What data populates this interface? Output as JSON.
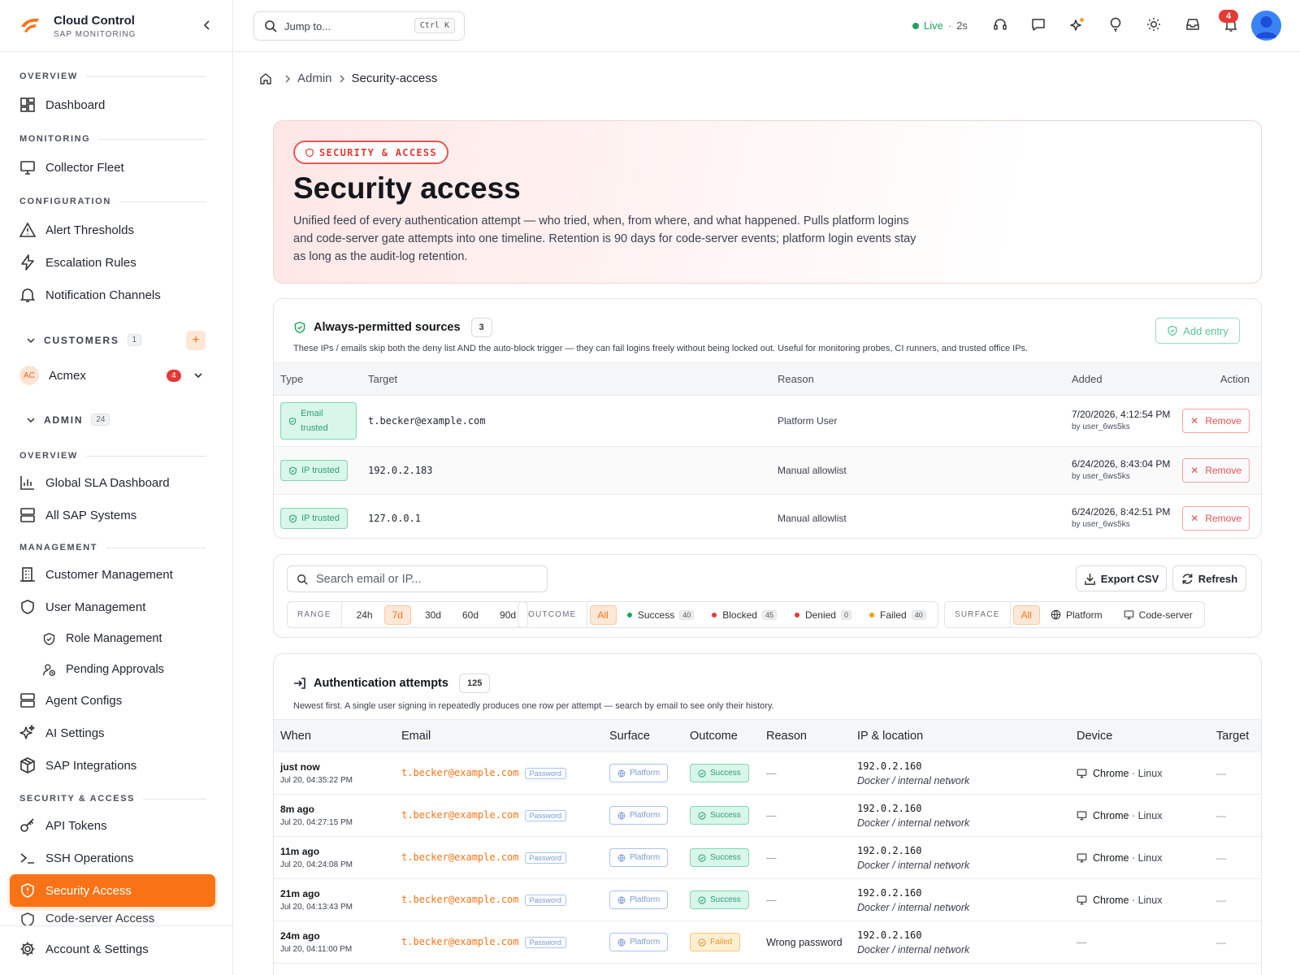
{
  "app": {
    "title": "Cloud Control",
    "subtitle": "SAP MONITORING"
  },
  "sidebar": {
    "sections": {
      "overview": "OVERVIEW",
      "monitoring": "MONITORING",
      "configuration": "CONFIGURATION",
      "admin_overview": "OVERVIEW",
      "management": "MANAGEMENT",
      "security": "SECURITY & ACCESS"
    },
    "items": {
      "dashboard": "Dashboard",
      "collector_fleet": "Collector Fleet",
      "alert_thresholds": "Alert Thresholds",
      "escalation_rules": "Escalation Rules",
      "notification_channels": "Notification Channels",
      "global_sla": "Global SLA Dashboard",
      "all_sap": "All SAP Systems",
      "customer_mgmt": "Customer Management",
      "user_mgmt": "User Management",
      "role_mgmt": "Role Management",
      "pending_approvals": "Pending Approvals",
      "agent_configs": "Agent Configs",
      "ai_settings": "AI Settings",
      "sap_integrations": "SAP Integrations",
      "api_tokens": "API Tokens",
      "ssh_operations": "SSH Operations",
      "security_access": "Security Access",
      "code_server_access": "Code-server Access",
      "account_settings": "Account & Settings"
    },
    "customers": {
      "label": "CUSTOMERS",
      "count": "1",
      "add": "+"
    },
    "customer": {
      "initials": "AC",
      "name": "Acmex",
      "badge": "4"
    },
    "admin": {
      "label": "ADMIN",
      "count": "24"
    }
  },
  "topbar": {
    "search_placeholder": "Jump to...",
    "shortcut": "Ctrl K",
    "live_label": "Live",
    "live_age": "2s",
    "notification_count": "4"
  },
  "breadcrumb": {
    "admin": "Admin",
    "current": "Security-access"
  },
  "hero": {
    "pill": "SECURITY & ACCESS",
    "title": "Security access",
    "description": "Unified feed of every authentication attempt — who tried, when, from where, and what happened. Pulls platform logins and code-server gate attempts into one timeline. Retention is 90 days for code-server events; platform login events stay as long as the audit-log retention."
  },
  "permitted": {
    "title": "Always-permitted sources",
    "count": "3",
    "description": "These IPs / emails skip both the deny list AND the auto-block trigger — they can fail logins freely without being locked out. Useful for monitoring probes, CI runners, and trusted office IPs.",
    "add_label": "Add entry",
    "columns": [
      "Type",
      "Target",
      "Reason",
      "Added",
      "Action"
    ],
    "remove_label": "Remove",
    "rows": [
      {
        "type": "Email trusted",
        "target": "t.becker@example.com",
        "reason": "Platform User",
        "added": "7/20/2026, 4:12:54 PM",
        "by": "by user_6ws5ks"
      },
      {
        "type": "IP trusted",
        "target": "192.0.2.183",
        "reason": "Manual allowlist",
        "added": "6/24/2026, 8:43:04 PM",
        "by": "by user_6ws5ks"
      },
      {
        "type": "IP trusted",
        "target": "127.0.0.1",
        "reason": "Manual allowlist",
        "added": "6/24/2026, 8:42:51 PM",
        "by": "by user_6ws5ks"
      }
    ]
  },
  "filters": {
    "search_placeholder": "Search email or IP...",
    "export_label": "Export CSV",
    "refresh_label": "Refresh",
    "range": {
      "label": "RANGE",
      "options": [
        "24h",
        "7d",
        "30d",
        "60d",
        "90d"
      ],
      "selected": "7d"
    },
    "outcome": {
      "label": "OUTCOME",
      "all": "All",
      "options": [
        {
          "label": "Success",
          "count": "40",
          "color": "#1fa463"
        },
        {
          "label": "Blocked",
          "count": "45",
          "color": "#e53935"
        },
        {
          "label": "Denied",
          "count": "0",
          "color": "#e53935"
        },
        {
          "label": "Failed",
          "count": "40",
          "color": "#f59e0b"
        }
      ]
    },
    "surface": {
      "label": "SURFACE",
      "all": "All",
      "platform": "Platform",
      "code_server": "Code-server"
    }
  },
  "attempts": {
    "title": "Authentication attempts",
    "count": "125",
    "description": "Newest first. A single user signing in repeatedly produces one row per attempt — search by email to see only their history.",
    "columns": [
      "When",
      "Email",
      "Surface",
      "Outcome",
      "Reason",
      "IP & location",
      "Device",
      "Target"
    ],
    "rows": [
      {
        "when": "just now",
        "ts": "Jul 20, 04:35:22 PM",
        "email": "t.becker@example.com",
        "method": "Password",
        "surface": "Platform",
        "outcome": "Success",
        "reason": "—",
        "ip": "192.0.2.160",
        "location": "Docker / internal network",
        "browser": "Chrome",
        "os": "Linux",
        "target": "—"
      },
      {
        "when": "8m ago",
        "ts": "Jul 20, 04:27:15 PM",
        "email": "t.becker@example.com",
        "method": "Password",
        "surface": "Platform",
        "outcome": "Success",
        "reason": "—",
        "ip": "192.0.2.160",
        "location": "Docker / internal network",
        "browser": "Chrome",
        "os": "Linux",
        "target": "—"
      },
      {
        "when": "11m ago",
        "ts": "Jul 20, 04:24:08 PM",
        "email": "t.becker@example.com",
        "method": "Password",
        "surface": "Platform",
        "outcome": "Success",
        "reason": "—",
        "ip": "192.0.2.160",
        "location": "Docker / internal network",
        "browser": "Chrome",
        "os": "Linux",
        "target": "—"
      },
      {
        "when": "21m ago",
        "ts": "Jul 20, 04:13:43 PM",
        "email": "t.becker@example.com",
        "method": "Password",
        "surface": "Platform",
        "outcome": "Success",
        "reason": "—",
        "ip": "192.0.2.160",
        "location": "Docker / internal network",
        "browser": "Chrome",
        "os": "Linux",
        "target": "—"
      },
      {
        "when": "24m ago",
        "ts": "Jul 20, 04:11:00 PM",
        "email": "t.becker@example.com",
        "method": "Password",
        "surface": "Platform",
        "outcome": "Failed",
        "reason": "Wrong password",
        "ip": "192.0.2.160",
        "location": "Docker / internal network",
        "browser": "—",
        "os": "",
        "target": "—"
      }
    ]
  },
  "colors": {
    "accent": "#f97316",
    "success": "#1fa463",
    "danger": "#e53935"
  }
}
